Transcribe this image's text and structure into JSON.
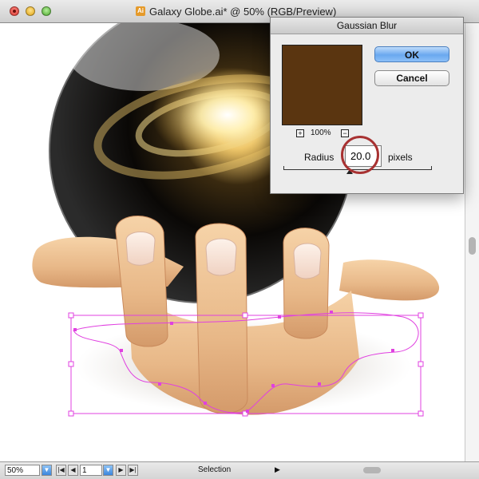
{
  "window": {
    "title": "Galaxy Globe.ai* @ 50% (RGB/Preview)",
    "doc_icon_glyph": "Ai"
  },
  "status": {
    "zoom": "50%",
    "page": "1",
    "tool": "Selection"
  },
  "dialog": {
    "title": "Gaussian Blur",
    "preview_color": "#5a3510",
    "zoom_percent": "100%",
    "ok_label": "OK",
    "cancel_label": "Cancel",
    "radius_label": "Radius",
    "radius_value": "20.0",
    "units_label": "pixels"
  },
  "colors": {
    "selection": "#e040e0",
    "highlight_ring": "#a83232",
    "accent": "#3b86dd"
  }
}
